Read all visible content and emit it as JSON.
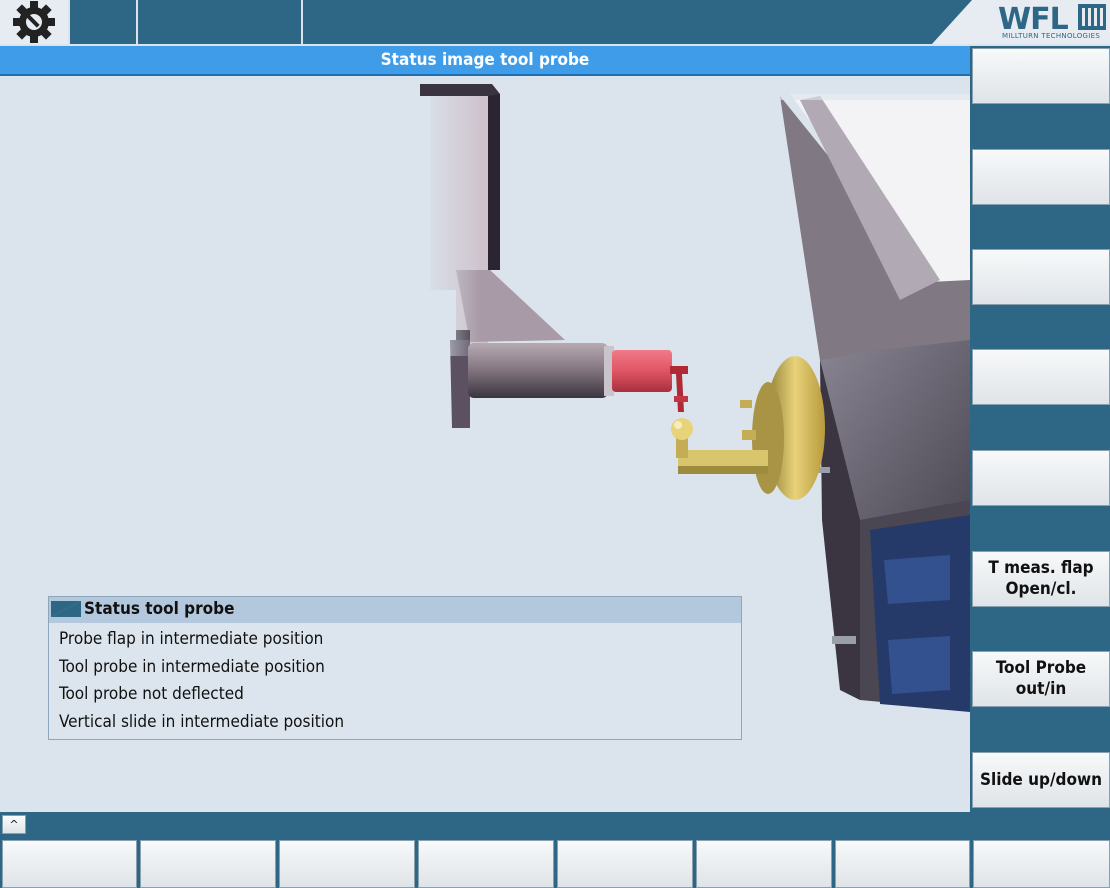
{
  "header": {
    "title": "Status image tool probe",
    "settings_icon": "gear-wrench-icon",
    "logo": {
      "name": "WFL",
      "subtitle": "MILLTURN TECHNOLOGIES"
    }
  },
  "status_panel": {
    "title": "Status tool probe",
    "items": [
      "Probe flap in intermediate position",
      "Tool probe in intermediate position",
      "Tool probe not deflected",
      "Vertical slide in intermediate position"
    ]
  },
  "vertical_softkeys": [
    "",
    "",
    "",
    "",
    "",
    "T meas. flap\nOpen/cl.",
    "Tool Probe\nout/in",
    "Slide up/down"
  ],
  "horizontal_softkeys": [
    "",
    "",
    "",
    "",
    "",
    "",
    "",
    ""
  ],
  "scroll_up_symbol": "^",
  "colors": {
    "accent": "#2e6786",
    "title_bar": "#3f9ce8",
    "background": "#dbe4ec"
  }
}
